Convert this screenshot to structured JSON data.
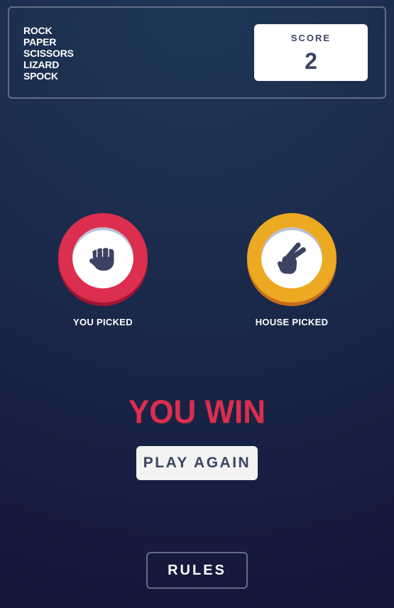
{
  "header": {
    "titles": [
      "ROCK",
      "PAPER",
      "SCISSORS",
      "LIZARD",
      "SPOCK"
    ],
    "score_label": "SCORE",
    "score_value": "2"
  },
  "game": {
    "you_picked_label": "YOU PICKED",
    "house_picked_label": "HOUSE PICKED",
    "you_pick": {
      "name": "rock",
      "icon": "fist-icon",
      "ring_color": "#dc2e4e"
    },
    "house_pick": {
      "name": "scissors",
      "icon": "scissors-hand-icon",
      "ring_color": "#eca922"
    },
    "result_text": "YOU WIN",
    "result_color": "#dc2e4e",
    "play_again_label": "PLAY AGAIN"
  },
  "footer": {
    "rules_label": "RULES"
  }
}
